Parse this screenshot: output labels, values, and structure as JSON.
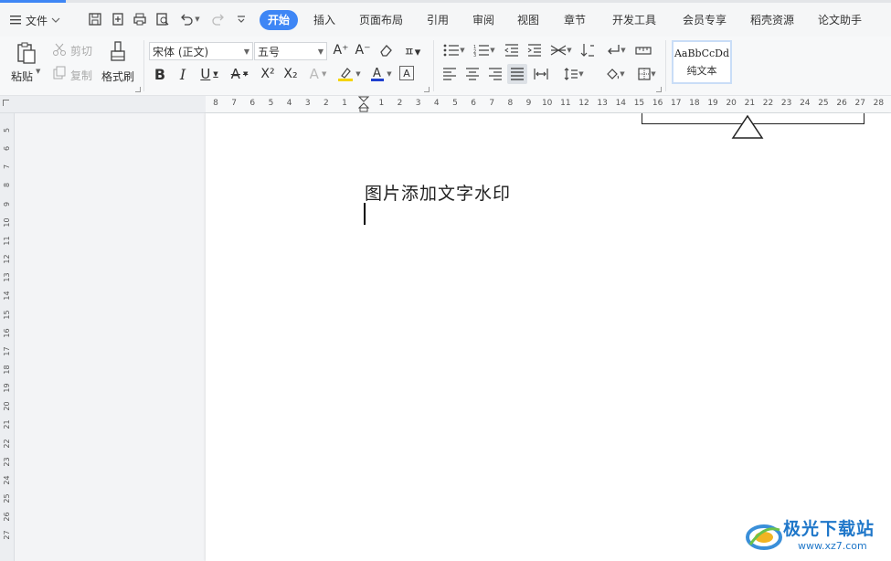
{
  "menu": {
    "file_label": "文件"
  },
  "tabs": [
    {
      "label": "开始",
      "active": true
    },
    {
      "label": "插入"
    },
    {
      "label": "页面布局"
    },
    {
      "label": "引用"
    },
    {
      "label": "审阅"
    },
    {
      "label": "视图"
    },
    {
      "label": "章节"
    },
    {
      "label": "开发工具"
    },
    {
      "label": "会员专享"
    },
    {
      "label": "稻壳资源"
    },
    {
      "label": "论文助手"
    }
  ],
  "ribbon": {
    "paste_label": "粘贴",
    "cut_label": "剪切",
    "copy_label": "复制",
    "format_painter_label": "格式刷",
    "font_name": "宋体 (正文)",
    "font_size": "五号",
    "style_sample": "AaBbCcDd",
    "style_name": "纯文本"
  },
  "ruler": {
    "horizontal": [
      "8",
      "7",
      "6",
      "5",
      "4",
      "3",
      "2",
      "1",
      "",
      "1",
      "2",
      "3",
      "4",
      "5",
      "6",
      "7",
      "8",
      "9",
      "10",
      "11",
      "12",
      "13",
      "14",
      "15",
      "16",
      "17",
      "18",
      "19",
      "20",
      "21",
      "22",
      "23",
      "24",
      "25",
      "26",
      "27",
      "28"
    ],
    "vertical": [
      "5",
      "6",
      "7",
      "8",
      "9",
      "10",
      "11",
      "12",
      "13",
      "14",
      "15",
      "16",
      "17",
      "18",
      "19",
      "20",
      "21",
      "22",
      "23",
      "24",
      "25",
      "26",
      "27"
    ]
  },
  "document": {
    "text": "图片添加文字水印"
  },
  "watermark": {
    "brand": "极光下载站",
    "url": "www.xz7.com"
  },
  "colors": {
    "accent": "#3e86f5",
    "highlight": "#f5d400",
    "font_color": "#1f3fcf"
  }
}
